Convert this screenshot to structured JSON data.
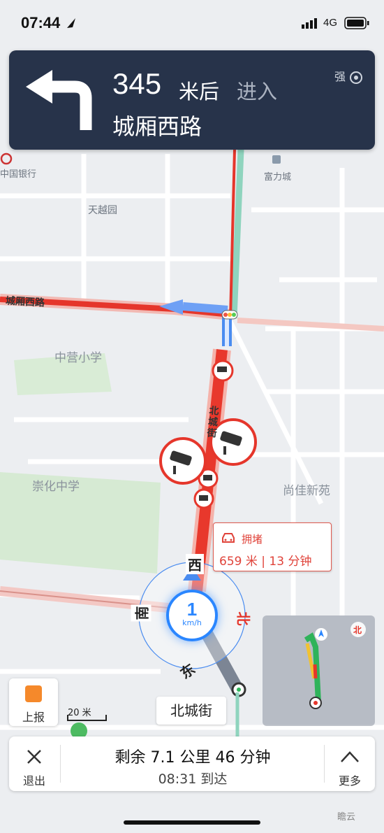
{
  "status": {
    "time": "07:44",
    "network": "4G"
  },
  "nav": {
    "distance": "345",
    "unit": "米后",
    "action": "进入",
    "road": "城厢西路",
    "signal": "强"
  },
  "pois": {
    "bank": "中国银行",
    "mall": "富力城",
    "tianyue": "天越园",
    "school1": "中营小学",
    "school2": "崇化中学",
    "shangjia": "尚佳新苑"
  },
  "roads": {
    "chengxiang": "城厢西路",
    "beicheng_vertical": "北城街"
  },
  "congestion": {
    "title": "拥堵",
    "distance": "659 米",
    "time": "13 分钟"
  },
  "compass": {
    "west": "西",
    "south": "南",
    "north": "北",
    "east": "东"
  },
  "speed": {
    "value": "1",
    "unit": "km/h"
  },
  "report": {
    "label": "上报"
  },
  "scale": {
    "label": "20 米"
  },
  "current_street": "北城街",
  "minimap": {
    "north": "北"
  },
  "bottom": {
    "exit": "退出",
    "more": "更多",
    "remaining": "剩余 7.1 公里 46 分钟",
    "arrival": "08:31 到达"
  },
  "watermark": "瞻云"
}
